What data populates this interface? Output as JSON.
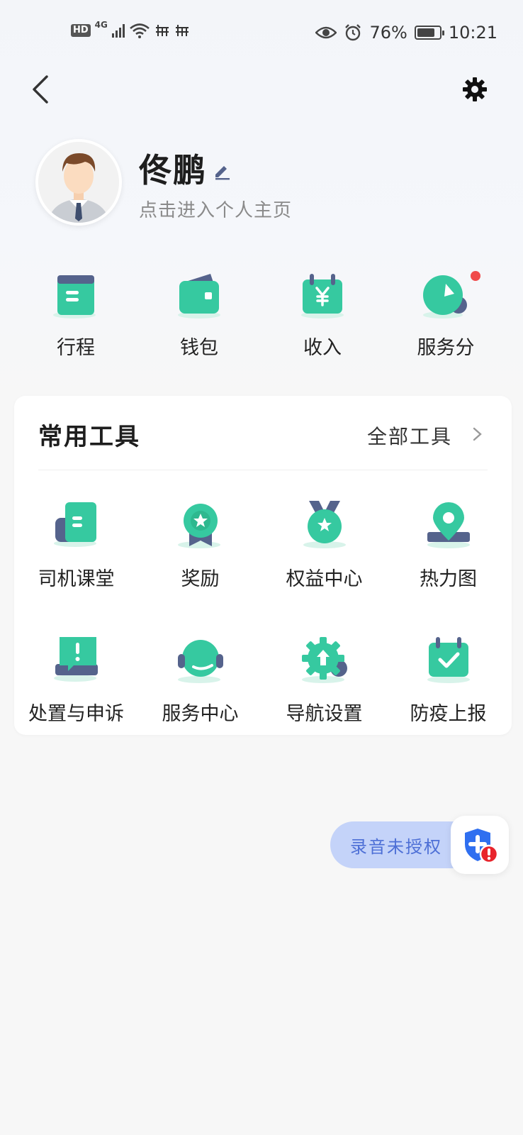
{
  "status_bar": {
    "hd": "HD",
    "network": "4G",
    "battery": "76%",
    "time": "10:21"
  },
  "header": {
    "back_icon": "chevron-left-icon",
    "settings_icon": "gear-icon"
  },
  "profile": {
    "name": "佟鹏",
    "subtitle": "点击进入个人主页"
  },
  "quick_items": [
    {
      "label": "行程",
      "icon": "trip-card-icon"
    },
    {
      "label": "钱包",
      "icon": "wallet-icon"
    },
    {
      "label": "收入",
      "icon": "income-calendar-icon"
    },
    {
      "label": "服务分",
      "icon": "service-score-icon",
      "badge": true
    }
  ],
  "tools": {
    "title": "常用工具",
    "all_label": "全部工具",
    "items": [
      {
        "label": "司机课堂",
        "icon": "book-icon"
      },
      {
        "label": "奖励",
        "icon": "award-icon"
      },
      {
        "label": "权益中心",
        "icon": "medal-icon"
      },
      {
        "label": "热力图",
        "icon": "map-pin-icon"
      },
      {
        "label": "处置与申诉",
        "icon": "complaint-icon"
      },
      {
        "label": "服务中心",
        "icon": "headset-icon"
      },
      {
        "label": "导航设置",
        "icon": "navigation-gear-icon"
      },
      {
        "label": "防疫上报",
        "icon": "check-calendar-icon"
      }
    ]
  },
  "floating": {
    "recording_label": "录音未授权",
    "shield_icon": "shield-alert-icon"
  },
  "colors": {
    "accent_green": "#36c9a0",
    "accent_blue_gray": "#55638c",
    "pill_bg": "#c4d3f9",
    "pill_text": "#4d6fd6",
    "badge_red": "#f04a4a"
  }
}
